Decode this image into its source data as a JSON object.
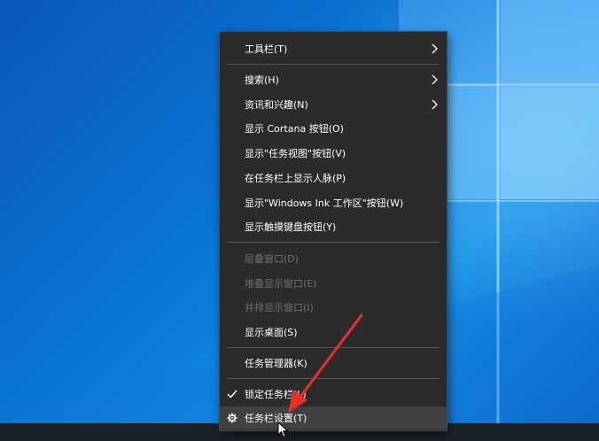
{
  "menu": {
    "items": [
      {
        "label": "工具栏(T)",
        "submenu": true,
        "disabled": false
      },
      {
        "label": "搜索(H)",
        "submenu": true,
        "disabled": false
      },
      {
        "label": "资讯和兴趣(N)",
        "submenu": true,
        "disabled": false
      },
      {
        "label": "显示 Cortana 按钮(O)",
        "submenu": false,
        "disabled": false
      },
      {
        "label": "显示\"任务视图\"按钮(V)",
        "submenu": false,
        "disabled": false
      },
      {
        "label": "在任务栏上显示人脉(P)",
        "submenu": false,
        "disabled": false
      },
      {
        "label": "显示\"Windows Ink 工作区\"按钮(W)",
        "submenu": false,
        "disabled": false
      },
      {
        "label": "显示触摸键盘按钮(Y)",
        "submenu": false,
        "disabled": false
      },
      {
        "label": "层叠窗口(D)",
        "submenu": false,
        "disabled": true
      },
      {
        "label": "堆叠显示窗口(E)",
        "submenu": false,
        "disabled": true
      },
      {
        "label": "并排显示窗口(I)",
        "submenu": false,
        "disabled": true
      },
      {
        "label": "显示桌面(S)",
        "submenu": false,
        "disabled": false
      },
      {
        "label": "任务管理器(K)",
        "submenu": false,
        "disabled": false
      },
      {
        "label": "锁定任务栏(L)",
        "checked": true,
        "disabled": false
      },
      {
        "label": "任务栏设置(T)",
        "icon": "gear-icon",
        "hovered": true,
        "disabled": false
      }
    ]
  },
  "colors": {
    "menu_bg": "#2b2b2b",
    "hover_bg": "#414141",
    "disabled_text": "#6f6f6f",
    "annotation_arrow": "#e8302a"
  }
}
